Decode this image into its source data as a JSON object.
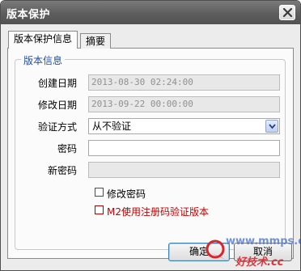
{
  "window": {
    "title": "版本保护"
  },
  "tabs": [
    {
      "label": "版本保护信息",
      "active": true
    },
    {
      "label": "摘要",
      "active": false
    }
  ],
  "group": {
    "title": "版本信息",
    "created_label": "创建日期",
    "created_value": "2013-08-30 02:24:00",
    "modified_label": "修改日期",
    "modified_value": "2013-09-22 00:00:00",
    "verify_label": "验证方式",
    "verify_value": "从不验证",
    "password_label": "密码",
    "password_value": "",
    "new_password_label": "新密码",
    "new_password_value": "",
    "change_password_label": "修改密码",
    "m2_label": "M2使用注册码验证版本"
  },
  "buttons": {
    "ok": "确定",
    "cancel": "取消"
  },
  "watermark": {
    "line1": "www.mmps.cc",
    "line2": "好技术.cc"
  },
  "colors": {
    "titlebar": "#5d5d5d",
    "group_title": "#1f4fa8",
    "warning_text": "#c00000"
  },
  "icons": {
    "close": "close-icon",
    "dropdown": "chevron-down-icon",
    "logo": "watermark-logo-icon"
  }
}
